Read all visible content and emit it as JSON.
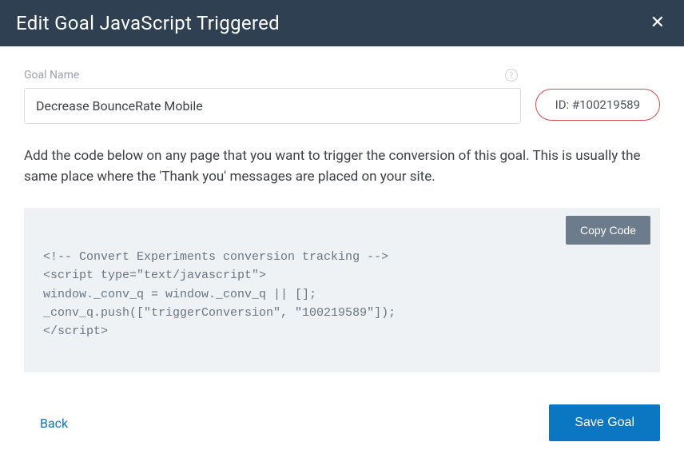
{
  "header": {
    "title": "Edit Goal JavaScript Triggered"
  },
  "form": {
    "goal_name_label": "Goal Name",
    "goal_name_value": "Decrease BounceRate Mobile",
    "id_text": "ID: #100219589"
  },
  "instruction": "Add the code below on any page that you want to trigger the conversion of this goal. This is usually the same place where the 'Thank you' messages are placed on your site.",
  "code": {
    "copy_label": "Copy Code",
    "snippet": "<!-- Convert Experiments conversion tracking -->\n<script type=\"text/javascript\">\nwindow._conv_q = window._conv_q || [];\n_conv_q.push([\"triggerConversion\", \"100219589\"]);\n</script>"
  },
  "footer": {
    "back_label": "Back",
    "save_label": "Save Goal"
  }
}
